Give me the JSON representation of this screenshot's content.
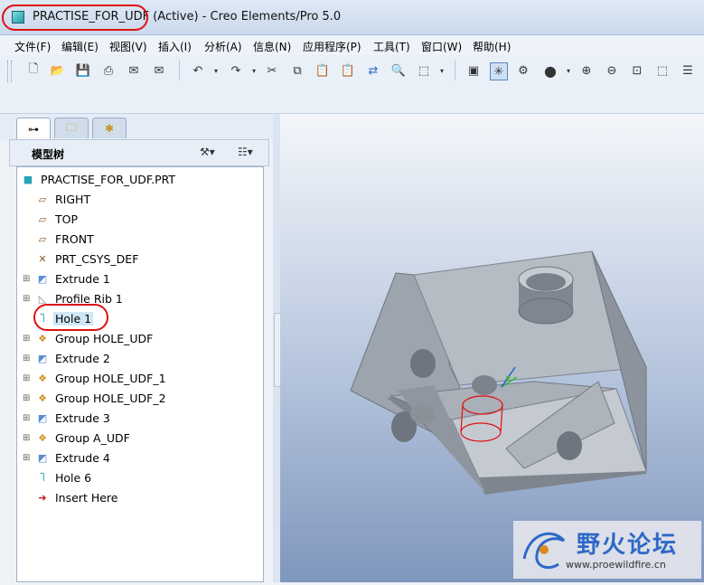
{
  "window": {
    "title": "PRACTISE_FOR_UDF (Active) - Creo Elements/Pro 5.0"
  },
  "menu": {
    "items": [
      "文件(F)",
      "编辑(E)",
      "视图(V)",
      "插入(I)",
      "分析(A)",
      "信息(N)",
      "应用程序(P)",
      "工具(T)",
      "窗口(W)",
      "帮助(H)"
    ]
  },
  "toolbar": {
    "icons": [
      "new-icon",
      "open-icon",
      "save-icon",
      "print-icon",
      "send-icon",
      "undo-icon",
      "redo-icon",
      "cut-icon",
      "copy-icon",
      "paste-icon",
      "regen-icon",
      "find-icon",
      "select-box-icon",
      "repaint-icon",
      "orient-icon",
      "spin-center-icon",
      "shade-icon",
      "zoom-in-icon",
      "zoom-out-icon",
      "refit-icon",
      "annotation-icon",
      "layers-icon"
    ]
  },
  "model_tree": {
    "header": "模型树",
    "items": [
      {
        "label": "PRACTISE_FOR_UDF.PRT",
        "icon": "part-icon",
        "expandable": false,
        "root": true
      },
      {
        "label": "RIGHT",
        "icon": "datum-plane-icon",
        "expandable": false
      },
      {
        "label": "TOP",
        "icon": "datum-plane-icon",
        "expandable": false
      },
      {
        "label": "FRONT",
        "icon": "datum-plane-icon",
        "expandable": false
      },
      {
        "label": "PRT_CSYS_DEF",
        "icon": "csys-icon",
        "expandable": false
      },
      {
        "label": "Extrude 1",
        "icon": "extrude-icon",
        "expandable": true
      },
      {
        "label": "Profile Rib 1",
        "icon": "rib-icon",
        "expandable": true
      },
      {
        "label": "Hole 1",
        "icon": "hole-icon",
        "expandable": false,
        "selected": true
      },
      {
        "label": "Group HOLE_UDF",
        "icon": "group-icon",
        "expandable": true
      },
      {
        "label": "Extrude 2",
        "icon": "extrude-icon",
        "expandable": true
      },
      {
        "label": "Group HOLE_UDF_1",
        "icon": "group-icon",
        "expandable": true
      },
      {
        "label": "Group HOLE_UDF_2",
        "icon": "group-icon",
        "expandable": true
      },
      {
        "label": "Extrude 3",
        "icon": "extrude-icon",
        "expandable": true
      },
      {
        "label": "Group A_UDF",
        "icon": "group-icon",
        "expandable": true
      },
      {
        "label": "Extrude 4",
        "icon": "extrude-icon",
        "expandable": true
      },
      {
        "label": "Hole 6",
        "icon": "hole-icon",
        "expandable": false
      },
      {
        "label": "Insert Here",
        "icon": "insert-arrow-icon",
        "expandable": false
      }
    ]
  },
  "watermark": {
    "cn": "野火论坛",
    "en": "www.proewildfire.cn"
  },
  "colors": {
    "highlight_red": "#e01010",
    "selection": "#cfe7f7",
    "part_gray": "#9aa2ab"
  }
}
